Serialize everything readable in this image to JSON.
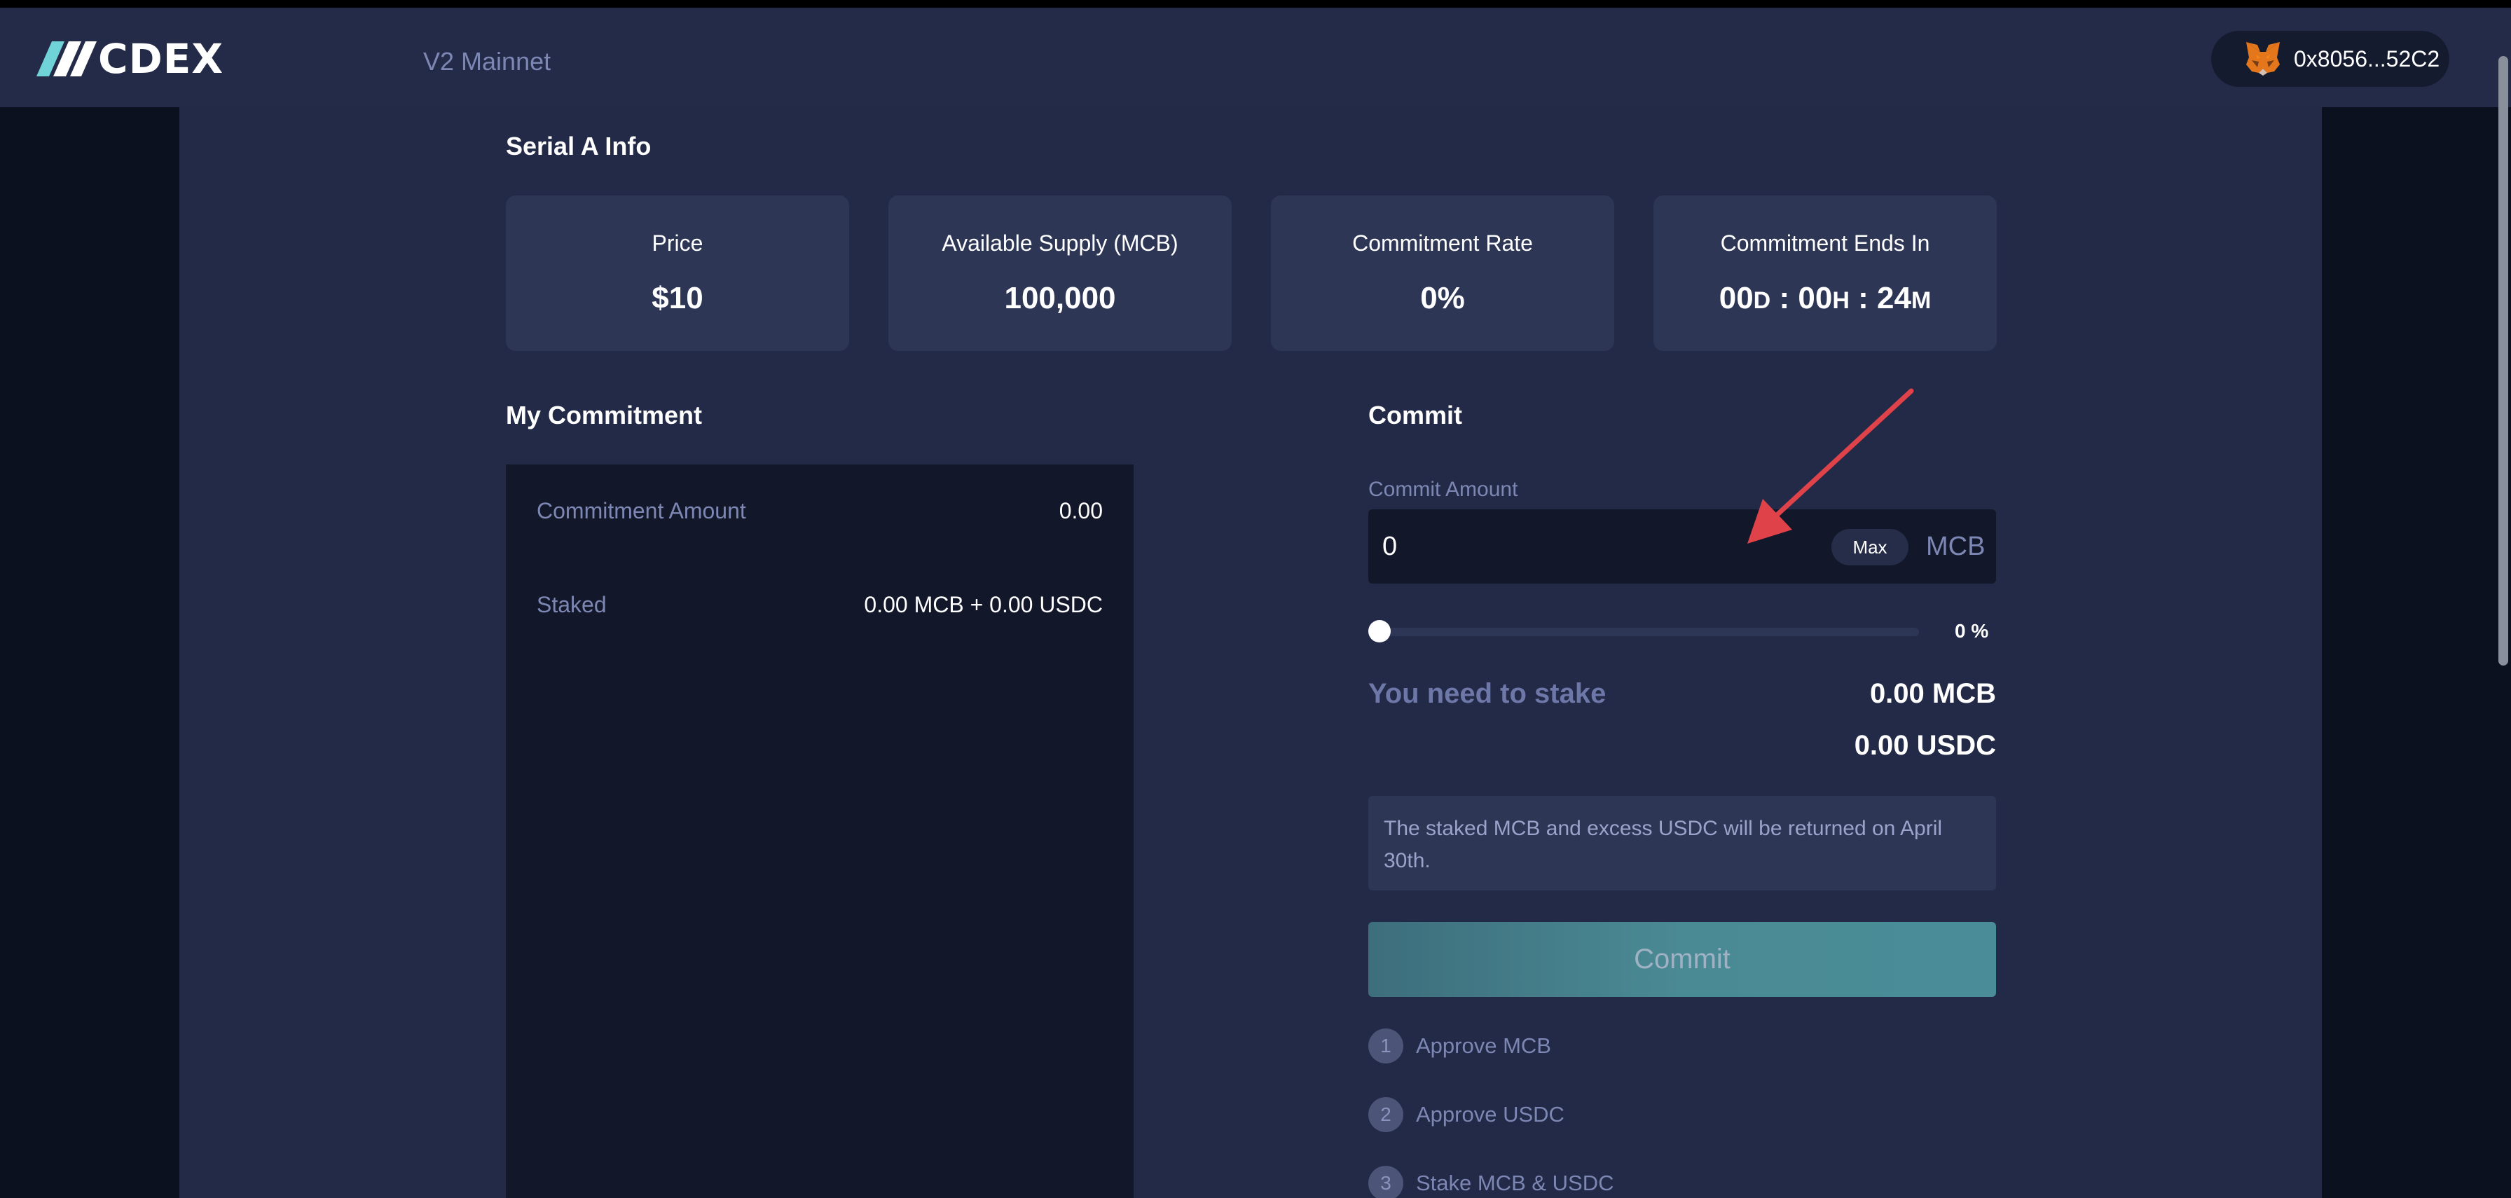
{
  "header": {
    "logo_text": "CDEX",
    "network": "V2 Mainnet",
    "wallet_address": "0x8056...52C2"
  },
  "serial_info": {
    "title": "Serial A Info",
    "cards": [
      {
        "label": "Price",
        "value": "$10"
      },
      {
        "label": "Available Supply (MCB)",
        "value": "100,000"
      },
      {
        "label": "Commitment Rate",
        "value": "0%"
      },
      {
        "label": "Commitment Ends In",
        "days": "00",
        "d_unit": "D",
        "hours": "00",
        "h_unit": "H",
        "minutes": "24",
        "m_unit": "M",
        "sep": ":"
      }
    ]
  },
  "my_commitment": {
    "title": "My Commitment",
    "commitment_amount_label": "Commitment Amount",
    "commitment_amount_value": "0.00",
    "staked_label": "Staked",
    "staked_value": "0.00 MCB + 0.00 USDC"
  },
  "commit": {
    "title": "Commit",
    "field_label": "Commit Amount",
    "amount_value": "0",
    "max_label": "Max",
    "unit": "MCB",
    "slider_percent": 0,
    "slider_label": "0 %",
    "stake_label": "You need to stake",
    "stake_mcb": "0.00 MCB",
    "stake_usdc": "0.00 USDC",
    "notice": "The staked MCB and excess USDC will be returned on April 30th.",
    "button_label": "Commit",
    "steps": [
      {
        "num": "1",
        "label": "Approve MCB"
      },
      {
        "num": "2",
        "label": "Approve USDC"
      },
      {
        "num": "3",
        "label": "Stake MCB & USDC"
      }
    ]
  },
  "colors": {
    "background": "#0c1120",
    "panel": "#232a47",
    "card": "#2e3656",
    "muted_text": "#7d87b3",
    "commit_button": "#4a8a94",
    "annotation_arrow": "#e0424a"
  }
}
